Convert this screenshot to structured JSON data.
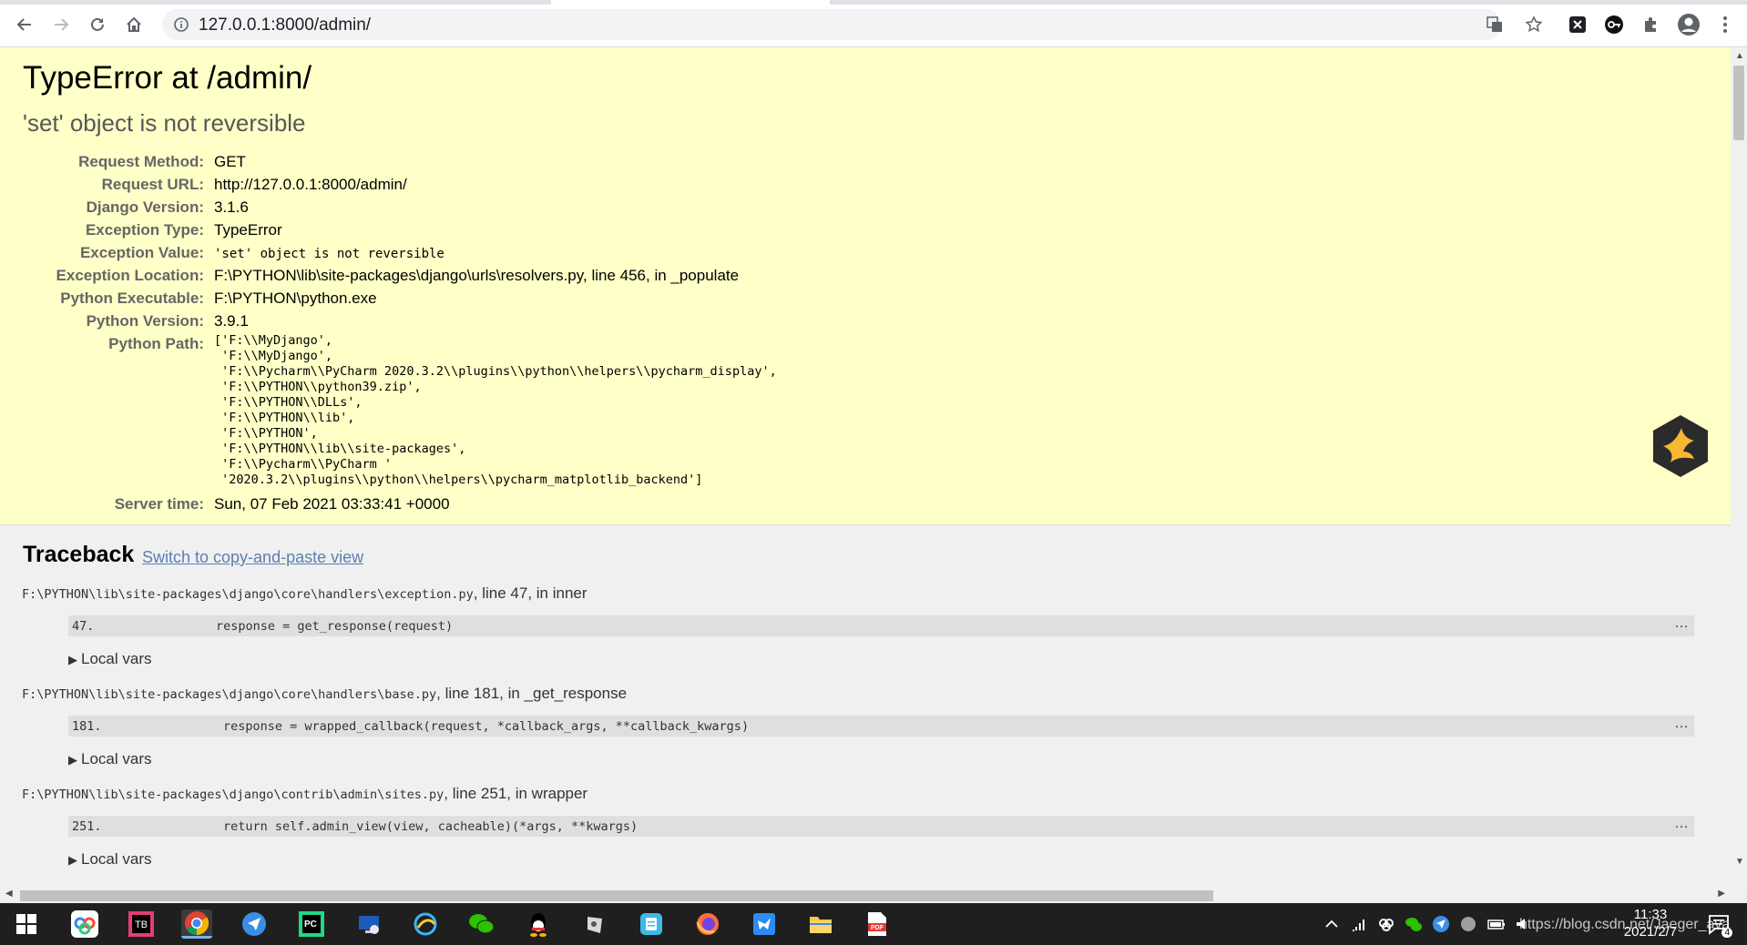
{
  "browser": {
    "url": "127.0.0.1:8000/admin/",
    "icons": [
      "back-icon",
      "forward-icon",
      "reload-icon",
      "home-icon",
      "site-info-icon",
      "translate-icon",
      "bookmark-star-icon",
      "extension-x-icon",
      "extension-key-icon",
      "extensions-puzzle-icon",
      "profile-icon",
      "menu-dots-icon"
    ]
  },
  "summary": {
    "title": "TypeError at /admin/",
    "subtitle": "'set' object is not reversible",
    "rows": [
      {
        "key": "Request Method:",
        "value": "GET"
      },
      {
        "key": "Request URL:",
        "value": "http://127.0.0.1:8000/admin/"
      },
      {
        "key": "Django Version:",
        "value": "3.1.6"
      },
      {
        "key": "Exception Type:",
        "value": "TypeError"
      },
      {
        "key": "Exception Value:",
        "value": "'set' object is not reversible"
      },
      {
        "key": "Exception Location:",
        "value": "F:\\PYTHON\\lib\\site-packages\\django\\urls\\resolvers.py, line 456, in _populate"
      },
      {
        "key": "Python Executable:",
        "value": "F:\\PYTHON\\python.exe"
      },
      {
        "key": "Python Version:",
        "value": "3.9.1"
      },
      {
        "key": "Python Path:",
        "value": "['F:\\\\MyDjango',\n 'F:\\\\MyDjango',\n 'F:\\\\Pycharm\\\\PyCharm 2020.3.2\\\\plugins\\\\python\\\\helpers\\\\pycharm_display',\n 'F:\\\\PYTHON\\\\python39.zip',\n 'F:\\\\PYTHON\\\\DLLs',\n 'F:\\\\PYTHON\\\\lib',\n 'F:\\\\PYTHON',\n 'F:\\\\PYTHON\\\\lib\\\\site-packages',\n 'F:\\\\Pycharm\\\\PyCharm '\n '2020.3.2\\\\plugins\\\\python\\\\helpers\\\\pycharm_matplotlib_backend']"
      },
      {
        "key": "Server time:",
        "value": "Sun, 07 Feb 2021 03:33:41 +0000"
      }
    ]
  },
  "traceback": {
    "title": "Traceback",
    "switch_link": "Switch to copy-and-paste view",
    "frames": [
      {
        "path": "F:\\PYTHON\\lib\\site-packages\\django\\core\\handlers\\exception.py",
        "suffix": ", line 47, in inner",
        "line_no": "47.",
        "code": "response = get_response(request)",
        "dots": "…",
        "local_vars": "Local vars"
      },
      {
        "path": "F:\\PYTHON\\lib\\site-packages\\django\\core\\handlers\\base.py",
        "suffix": ", line 181, in _get_response",
        "line_no": "181.",
        "code": "response = wrapped_callback(request, *callback_args, **callback_kwargs)",
        "dots": "…",
        "local_vars": "Local vars"
      },
      {
        "path": "F:\\PYTHON\\lib\\site-packages\\django\\contrib\\admin\\sites.py",
        "suffix": ", line 251, in wrapper",
        "line_no": "251.",
        "code": "return self.admin_view(view, cacheable)(*args, **kwargs)",
        "dots": "…",
        "local_vars": "Local vars"
      }
    ]
  },
  "taskbar": {
    "apps": [
      "windows-start-icon",
      "app-baidu-netdisk-icon",
      "jetbrains-toolbox-icon",
      "chrome-icon",
      "feishu-icon",
      "pycharm-icon",
      "remote-desktop-icon",
      "browser-360-icon",
      "wechat-icon",
      "qq-icon",
      "app-icon",
      "app-note-icon",
      "firefox-icon",
      "app-bird-icon",
      "file-explorer-icon",
      "pdf-icon"
    ],
    "time": "11:33",
    "date": "2021/2/7",
    "watermark": "https://blog.csdn.net/Jaeger_ava",
    "notification_count": "4"
  },
  "colors": {
    "summary_bg": "#ffffc8",
    "traceback_bg": "#f0f0f0",
    "link": "#5b80b2",
    "code_bg": "#dfdfdf",
    "taskbar_bg": "#1f1f1f"
  }
}
